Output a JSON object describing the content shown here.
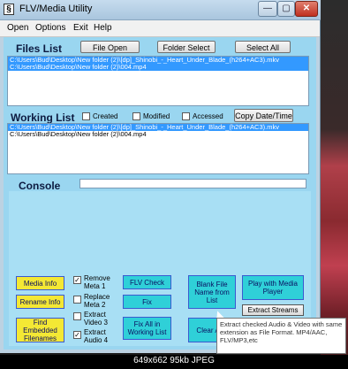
{
  "window": {
    "title": "FLV/Media Utility",
    "icon_letter": "§",
    "controls": {
      "minimize": "—",
      "maximize": "▢",
      "close": "✕"
    }
  },
  "menu": [
    "Open",
    "Options",
    "Exit",
    "Help"
  ],
  "files_list": {
    "label": "Files List",
    "buttons": {
      "file_open": "File Open",
      "folder_select": "Folder Select",
      "select_all": "Select All"
    },
    "items": [
      {
        "text": "C:\\Users\\Bud\\Desktop\\New folder (2)\\[dp]_Shinobi_-_Heart_Under_Blade_(h264+AC3).mkv",
        "selected": true
      },
      {
        "text": "C:\\Users\\Bud\\Desktop\\New folder (2)\\004.mp4",
        "selected": true
      }
    ]
  },
  "working_list": {
    "label": "Working List",
    "checkboxes": [
      {
        "label": "Created",
        "checked": false
      },
      {
        "label": "Modified",
        "checked": false
      },
      {
        "label": "Accessed",
        "checked": false
      }
    ],
    "copy_button": "Copy Date/Time",
    "items": [
      {
        "text": "C:\\Users\\Bud\\Desktop\\New folder (2)\\[dp]_Shinobi_-_Heart_Under_Blade_(h264+AC3).mkv",
        "selected": true
      },
      {
        "text": "C:\\Users\\Bud\\Desktop\\New folder (2)\\004.mp4",
        "selected": false
      }
    ]
  },
  "console": {
    "label": "Console",
    "value": ""
  },
  "actions": {
    "media_info": "Media Info",
    "rename_info": "Rename Info",
    "find_embedded": "Find Embedded Filenames",
    "options": [
      {
        "label": "Remove Meta 1",
        "checked": true
      },
      {
        "label": "Replace Meta 2",
        "checked": false
      },
      {
        "label": "Extract Video 3",
        "checked": false
      },
      {
        "label": "Extract Audio 4",
        "checked": true
      }
    ],
    "flv_check": "FLV Check",
    "fix": "Fix",
    "fix_all": "Fix All in Working List",
    "blank_file": "Blank File Name from List",
    "clear_all": "Clear ALL",
    "play_with": "Play with Media Player",
    "extract_streams": "Extract Streams"
  },
  "tooltip": "Extract checked Audio & Video with same extension as File Format. MP4/AAC, FLV/MP3,etc",
  "caption": "649x662  95kb  JPEG",
  "colors": {
    "accent_yellow": "#f4e834",
    "accent_cyan": "#2fd0d8",
    "selection": "#3399ff",
    "panel": "#9ad6f0"
  }
}
